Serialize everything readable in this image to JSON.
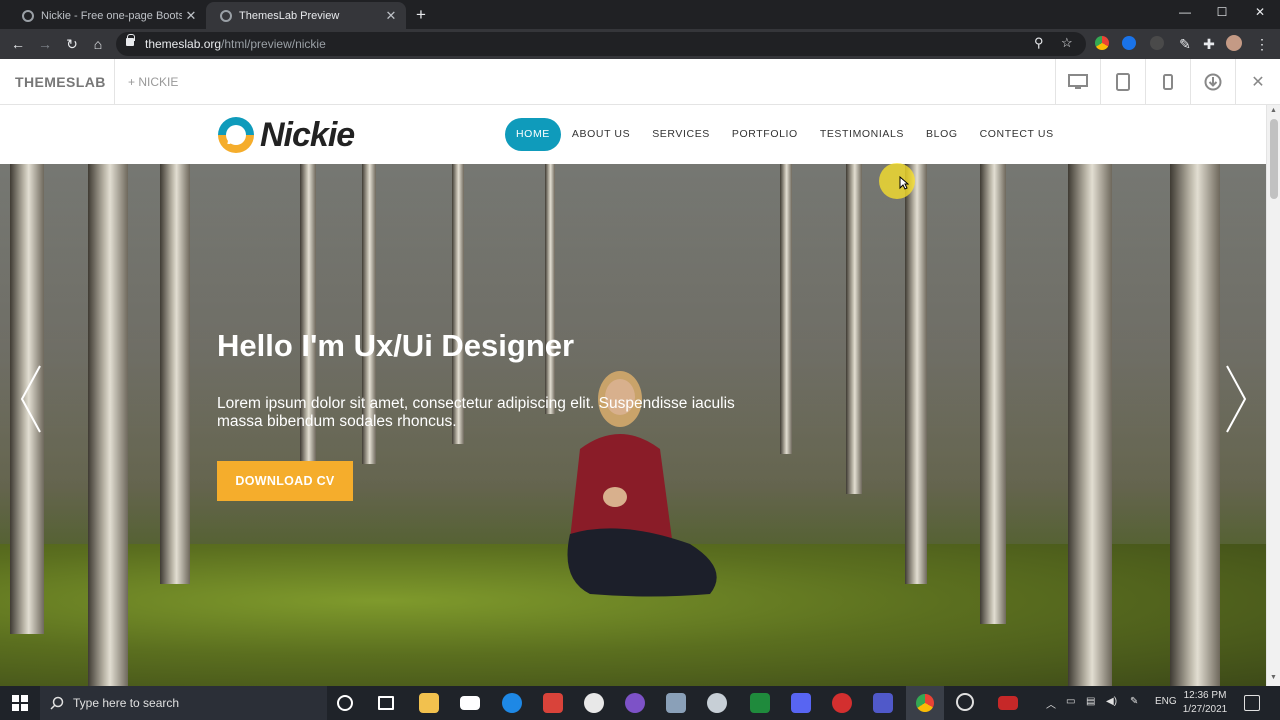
{
  "browser": {
    "tabs": [
      {
        "title": "Nickie - Free one-page Bootstrap"
      },
      {
        "title": "ThemesLab Preview"
      }
    ],
    "url_domain": "themeslab.org",
    "url_path": "/html/preview/nickie"
  },
  "preview_bar": {
    "brand": "THEMESLAB",
    "project": "NICKIE"
  },
  "site": {
    "logo_text": "Nickie",
    "nav": [
      "HOME",
      "ABOUT US",
      "SERVICES",
      "PORTFOLIO",
      "TESTIMONIALS",
      "BLOG",
      "CONTECT US"
    ],
    "active_nav": "HOME",
    "accent_color": "#0f9bbb",
    "button_color": "#f5ad2c"
  },
  "hero": {
    "title": "Hello I'm Ux/Ui Designer",
    "text": "Lorem ipsum dolor sit amet, consectetur adipiscing elit. Suspendisse iaculis massa bibendum sodales rhoncus.",
    "button": "DOWNLOAD CV"
  },
  "taskbar": {
    "search_placeholder": "Type here to search",
    "language": "ENG",
    "time": "12:36 PM",
    "date": "1/27/2021"
  }
}
